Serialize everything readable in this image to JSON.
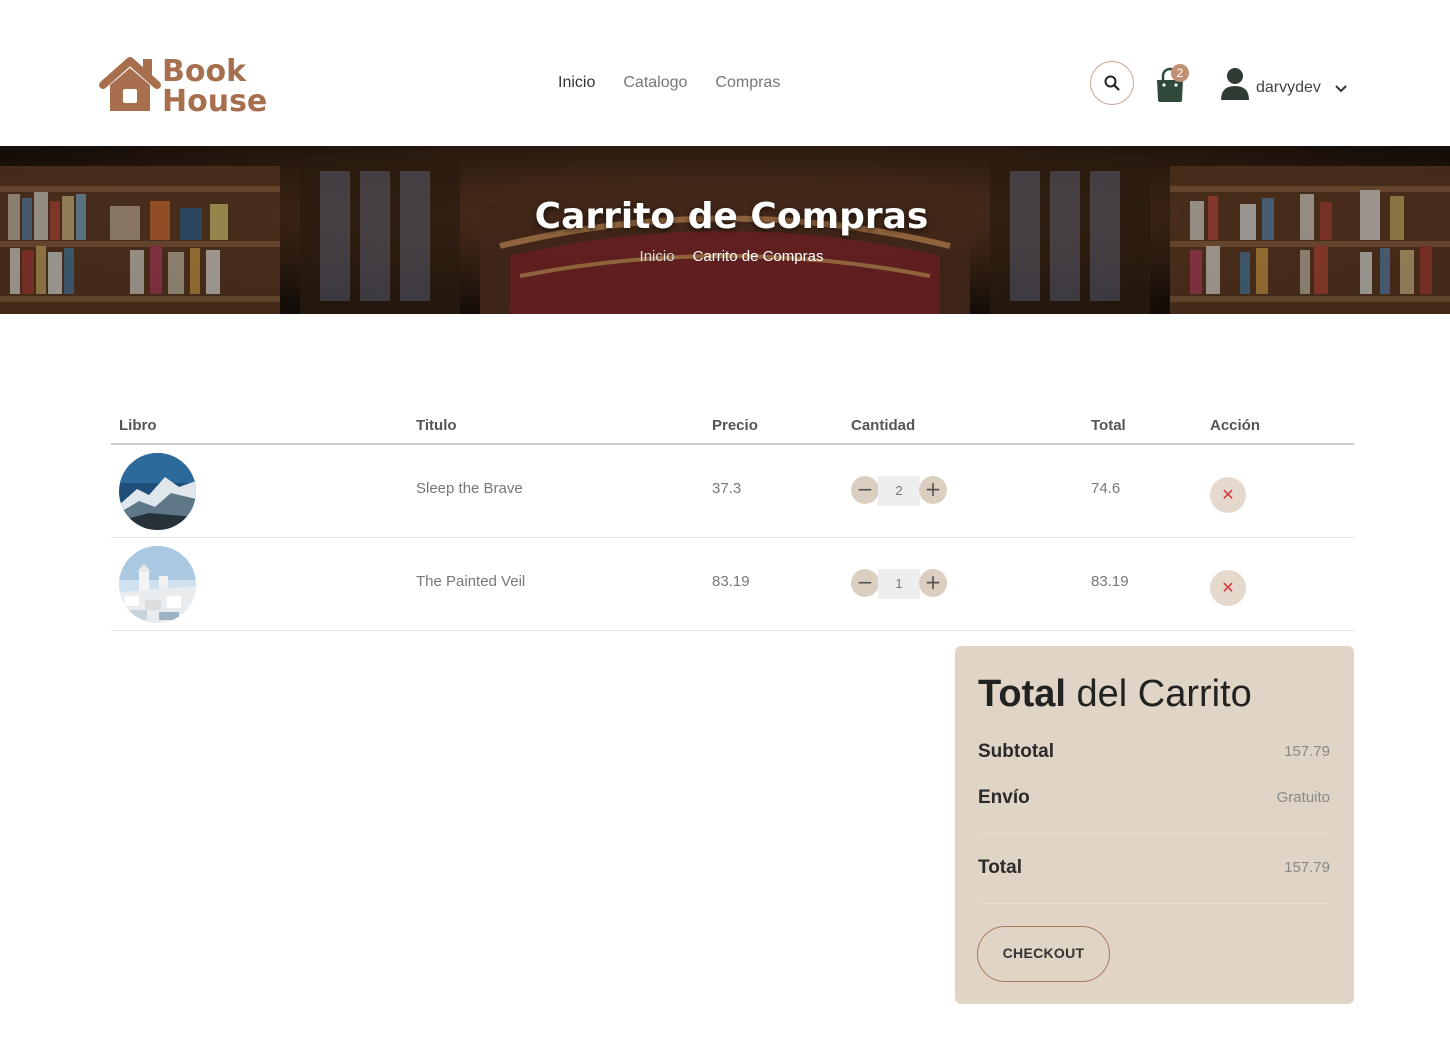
{
  "brand": {
    "line1": "Book",
    "line2": "House",
    "color": "#a86f4f"
  },
  "nav": {
    "items": [
      {
        "label": "Inicio",
        "active": true
      },
      {
        "label": "Catalogo",
        "active": false
      },
      {
        "label": "Compras",
        "active": false
      }
    ]
  },
  "header": {
    "cart_count": "2",
    "username": "darvydev",
    "icons": [
      "search-icon",
      "shopping-bag-icon",
      "user-icon",
      "chevron-down-icon"
    ]
  },
  "banner": {
    "title": "Carrito de Compras",
    "breadcrumb_home": "Inicio",
    "breadcrumb_current": "Carrito de Compras"
  },
  "table": {
    "headers": [
      "Libro",
      "Titulo",
      "Precio",
      "Cantidad",
      "Total",
      "Acción"
    ],
    "rows": [
      {
        "title": "Sleep the Brave",
        "price": "37.3",
        "qty": "2",
        "total": "74.6",
        "image": "mountain-photo"
      },
      {
        "title": "The Painted Veil",
        "price": "83.19",
        "qty": "1",
        "total": "83.19",
        "image": "santorini-photo"
      }
    ],
    "minus": "−",
    "plus": "+",
    "remove": "✕"
  },
  "summary": {
    "title_bold": "Total",
    "title_rest": " del Carrito",
    "subtotal_label": "Subtotal",
    "subtotal_value": "157.79",
    "shipping_label": "Envío",
    "shipping_value": "Gratuito",
    "total_label": "Total",
    "total_value": "157.79",
    "checkout_label": "CHECKOUT"
  },
  "colors": {
    "accent": "#c09072",
    "summary_bg": "#dfd4c6",
    "remove_icon": "#d13b3b"
  }
}
